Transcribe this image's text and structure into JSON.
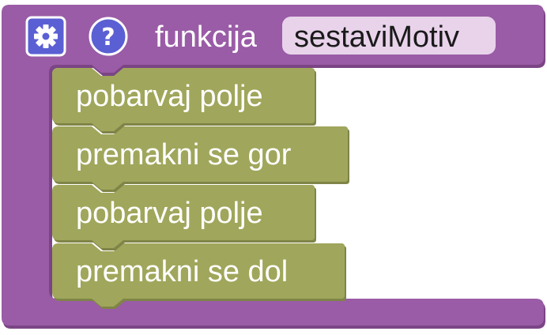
{
  "function_block": {
    "keyword": "funkcija",
    "name": "sestaviMotiv",
    "gear_icon": "gear-icon",
    "help_icon": "question-mark-icon",
    "help_glyph": "?"
  },
  "statements": [
    {
      "label": "pobarvaj polje"
    },
    {
      "label": "premakni se gor"
    },
    {
      "label": "pobarvaj polje"
    },
    {
      "label": "premakni se dol"
    }
  ],
  "colors": {
    "function_block": "#9a5ca6",
    "function_block_shadow": "#7b4585",
    "name_field": "#e8d3eb",
    "icon_bg": "#5b5fd4",
    "statement_block": "#a0a65b",
    "statement_shadow": "#7f8447"
  }
}
